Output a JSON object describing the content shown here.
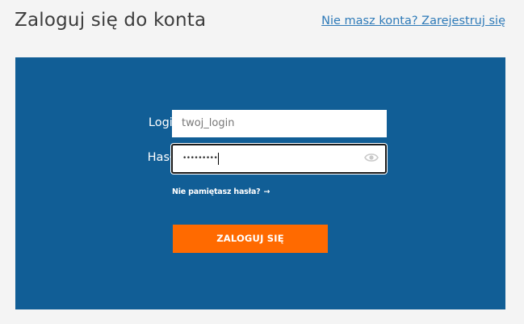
{
  "header": {
    "title": "Zaloguj się do konta",
    "register_link": "Nie masz konta? Zarejestruj się"
  },
  "form": {
    "login_label": "Login",
    "login_value": "twoj_login",
    "password_label": "Hasło",
    "password_masked": "•••••••••",
    "password_toggle_icon": "eye-icon",
    "forgot_link": "Nie pamiętasz hasła?",
    "forgot_arrow": "→",
    "submit_label": "ZALOGUJ SIĘ"
  },
  "colors": {
    "panel_bg": "#115e96",
    "page_bg": "#f4f4f4",
    "button_bg": "#ff6a00",
    "link": "#2e7ab8"
  }
}
